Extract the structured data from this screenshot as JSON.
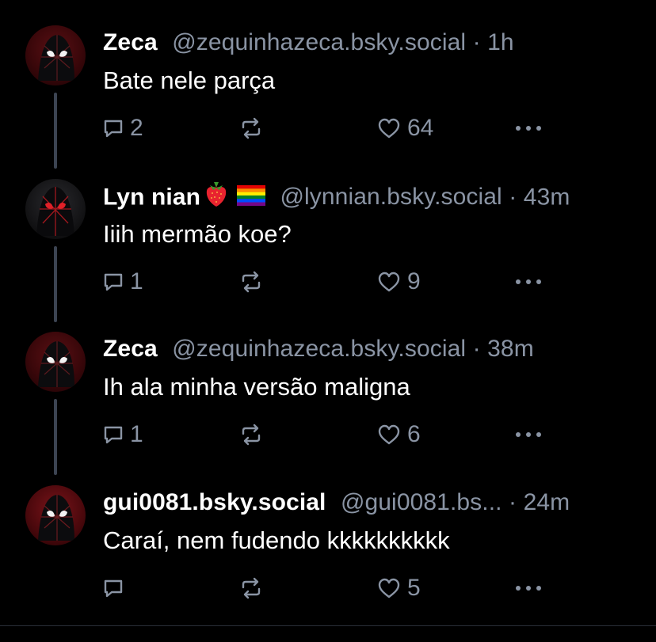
{
  "colors": {
    "background": "#000000",
    "text": "#ffffff",
    "muted": "#8a94a4",
    "thread_line": "#3c4452"
  },
  "posts": [
    {
      "name": "Zeca",
      "handle": "@zequinhazeca.bsky.social",
      "time": "1h",
      "text": "Bate nele parça",
      "replies": "2",
      "reposts": "",
      "likes": "64",
      "icons": [
        "reply-icon",
        "repost-icon",
        "heart-icon",
        "more-icon"
      ]
    },
    {
      "name": "Lyn nian",
      "emojis": [
        "strawberry",
        "rainbow-flag"
      ],
      "handle": "@lynnian.bsky.social",
      "time": "43m",
      "text": "Iiih mermão koe?",
      "replies": "1",
      "reposts": "",
      "likes": "9",
      "icons": [
        "reply-icon",
        "repost-icon",
        "heart-icon",
        "more-icon"
      ]
    },
    {
      "name": "Zeca",
      "handle": "@zequinhazeca.bsky.social",
      "time": "38m",
      "text": "Ih ala minha versão maligna",
      "replies": "1",
      "reposts": "",
      "likes": "6",
      "icons": [
        "reply-icon",
        "repost-icon",
        "heart-icon",
        "more-icon"
      ]
    },
    {
      "name": "gui0081.bsky.social",
      "handle": "@gui0081.bs...",
      "time": "24m",
      "text": "Caraí, nem fudendo kkkkkkkkkk",
      "replies": "",
      "reposts": "",
      "likes": "5",
      "icons": [
        "reply-icon",
        "repost-icon",
        "heart-icon",
        "more-icon"
      ]
    }
  ],
  "separator": " · "
}
